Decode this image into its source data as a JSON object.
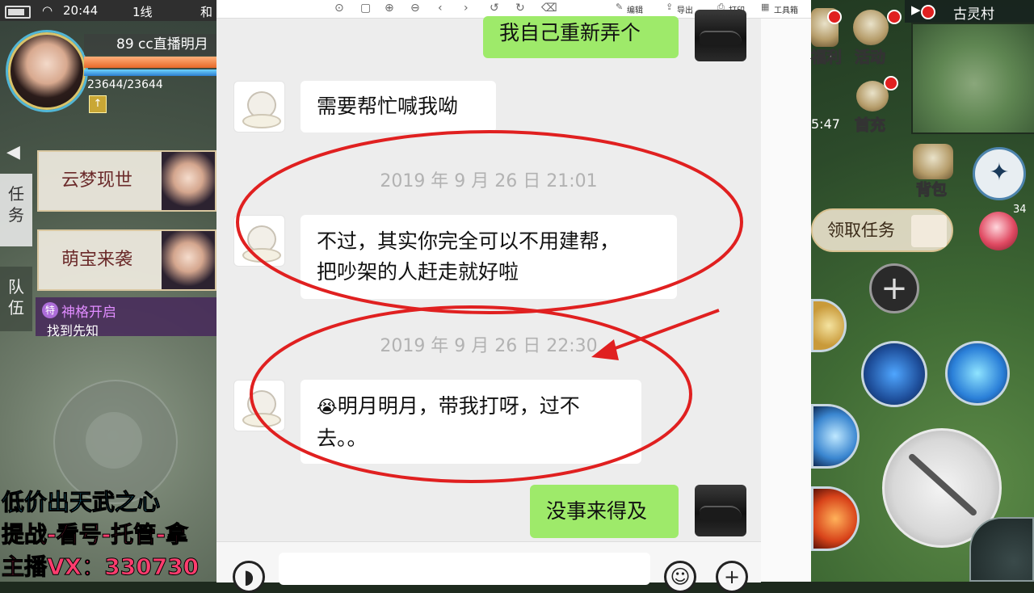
{
  "left_game": {
    "status_bar": {
      "time": "20:44",
      "line": "1线",
      "extra": "和"
    },
    "player": {
      "name": "89 cc直播明月",
      "hp": "23644/23644"
    },
    "side_tabs": {
      "task": "任务",
      "team": "队伍"
    },
    "quests": [
      {
        "title": "云梦现世"
      },
      {
        "title": "萌宝来袭"
      }
    ],
    "quest_extra": {
      "badge": "特",
      "title": "神格开启",
      "subtitle": "找到先知"
    },
    "promo": [
      "低价出天武之心",
      "提战-看号-托管-拿",
      "主播VX：330730"
    ]
  },
  "toolbar": {
    "edit": "编辑",
    "export": "导出",
    "print": "打印",
    "tools": "工具箱"
  },
  "chat": {
    "messages": [
      {
        "side": "right",
        "text": "我自己重新弄个"
      },
      {
        "side": "left",
        "text": "需要帮忙喊我呦"
      },
      {
        "timestamp": "2019 年 9 月 26 日 21:01"
      },
      {
        "side": "left",
        "text_line1": "不过，其实你完全可以不用建帮，",
        "text_line2": "把吵架的人赶走就好啦"
      },
      {
        "timestamp": "2019 年 9 月 26 日 22:30"
      },
      {
        "side": "left",
        "emoji": "😭",
        "text_line1": "明月明月，带我打呀，过不",
        "text_line2": "去。。"
      },
      {
        "side": "right",
        "text": "没事来得及"
      }
    ]
  },
  "right_game": {
    "map_name": "古灵村",
    "icons": {
      "welfare": "福利",
      "activity": "活动",
      "recharge": "首充",
      "bag": "背包",
      "time": "5:47"
    },
    "task_button": "领取任务",
    "potion_count": "34",
    "plus": "+"
  },
  "colors": {
    "chat_bg": "#ededed",
    "bubble_green": "#9eea6a",
    "annotation_red": "#e02020",
    "promo_blue": "#36d0ff",
    "promo_pink": "#ff3c6e"
  }
}
